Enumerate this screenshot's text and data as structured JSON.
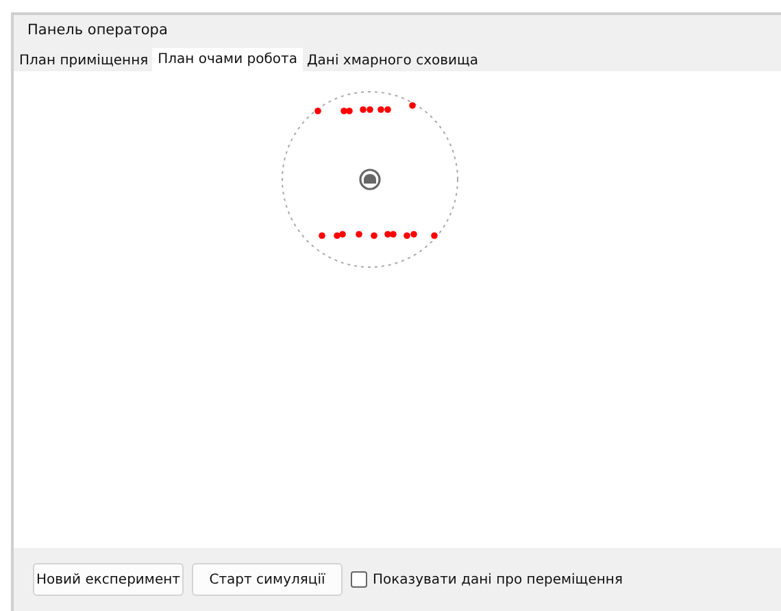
{
  "panel": {
    "title": "Панель оператора"
  },
  "tabs": [
    {
      "label": "План приміщення",
      "selected": false
    },
    {
      "label": "План очами робота",
      "selected": true
    },
    {
      "label": "Дані хмарного сховища",
      "selected": false
    }
  ],
  "buttons": [
    "Новий експеримент",
    "Старт симуляції"
  ],
  "checkbox": {
    "label": "Показувати дані про переміщення",
    "checked": false
  }
}
